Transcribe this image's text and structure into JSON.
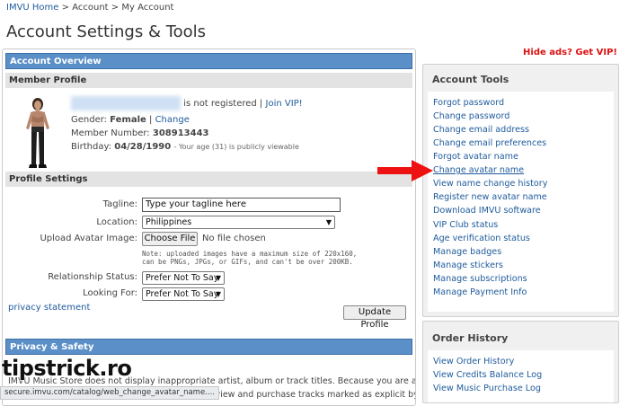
{
  "breadcrumb": {
    "home": "IMVU Home",
    "sep1": ">",
    "account": "Account",
    "sep2": ">",
    "current": "My Account"
  },
  "page_title": "Account Settings & Tools",
  "promo": {
    "hide_ads": "Hide ads? Get VIP!"
  },
  "account_overview": {
    "header": "Account Overview",
    "member_profile_header": "Member Profile",
    "not_registered_text": "is not registered |",
    "join_vip": "Join VIP!",
    "gender_label": "Gender:",
    "gender_value": "Female",
    "gender_sep": "|",
    "change_link": "Change",
    "member_number_label": "Member Number:",
    "member_number_value": "308913443",
    "birthday_label": "Birthday:",
    "birthday_value": "04/28/1990",
    "age_note": "- Your age (31) is publicly viewable"
  },
  "profile_settings": {
    "header": "Profile Settings",
    "tagline_label": "Tagline:",
    "tagline_value": "Type your tagline here",
    "location_label": "Location:",
    "location_value": "Philippines",
    "upload_label": "Upload Avatar Image:",
    "choose_file_button": "Choose File",
    "no_file_text": "No file chosen",
    "upload_note_1": "Note: uploaded images have a maximum size of 220x160,",
    "upload_note_2": "can be PNGs, JPGs, or GIFs, and can't be over 200KB.",
    "relationship_label": "Relationship Status:",
    "relationship_value": "Prefer Not To Say",
    "looking_for_label": "Looking For:",
    "looking_for_value": "Prefer Not To Say",
    "privacy_link": "privacy statement",
    "update_button": "Update Profile"
  },
  "privacy_safety": {
    "header": "Privacy & Safety",
    "music_store_line1": "IMVU Music Store does not display inappropriate artist, album or track titles. Because you are an",
    "music_store_line2": "to view and purchase tracks marked as explicit by the"
  },
  "account_tools": {
    "title": "Account Tools",
    "links": [
      "Forgot password",
      "Change password",
      "Change email address",
      "Change email preferences",
      "Forgot avatar name",
      "Change avatar name",
      "View name change history",
      "Register new avatar name",
      "Download IMVU software",
      "VIP Club status",
      "Age verification status",
      "Manage badges",
      "Manage stickers",
      "Manage subscriptions",
      "Manage Payment Info"
    ]
  },
  "order_history": {
    "title": "Order History",
    "links": [
      "View Order History",
      "View Credits Balance Log",
      "View Music Purchase Log"
    ]
  },
  "status_bar": {
    "url": "secure.imvu.com/catalog/web_change_avatar_name...."
  },
  "watermark": {
    "text": "tipstrick.ro"
  },
  "colors": {
    "header_blue": "#5b8fc7",
    "link": "#1f5b9c",
    "promo_red": "#dd1111",
    "arrow_red": "#ee1111"
  }
}
